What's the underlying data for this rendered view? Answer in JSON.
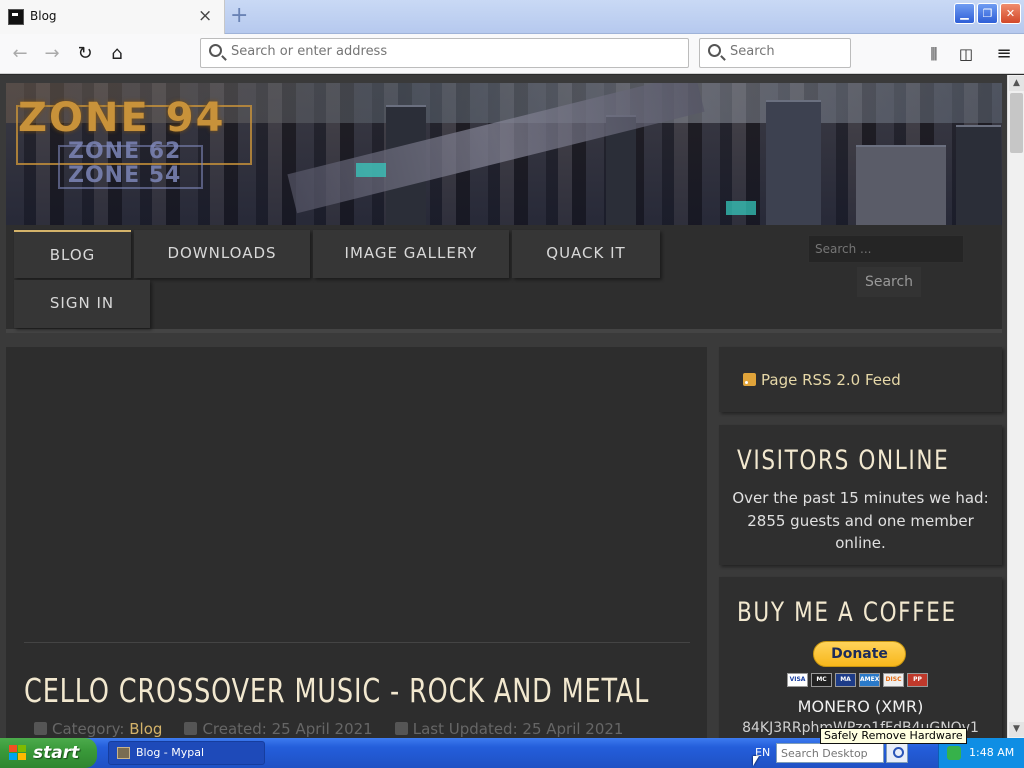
{
  "browser": {
    "tab_title": "Blog",
    "tab_close": "×",
    "new_tab": "+",
    "window_buttons": {
      "minimize": "▁",
      "restore": "❐",
      "close": "✕"
    },
    "address_placeholder": "Search or enter address",
    "search_placeholder": "Search",
    "nav_icons": [
      "back-icon",
      "forward-icon",
      "reload-icon",
      "home-icon",
      "library-icon",
      "sidebar-icon",
      "menu-icon"
    ]
  },
  "site": {
    "logo": {
      "main": "ZONE 94",
      "sub1": "ZONE 62",
      "sub2": "ZONE 54"
    },
    "menu": [
      {
        "label": "BLOG",
        "active": true
      },
      {
        "label": "DOWNLOADS"
      },
      {
        "label": "IMAGE GALLERY"
      },
      {
        "label": "QUACK IT"
      },
      {
        "label": "SIGN IN"
      }
    ],
    "search": {
      "placeholder": "Search ...",
      "button": "Search"
    },
    "article": {
      "title": "CELLO CROSSOVER MUSIC - ROCK AND METAL",
      "category_label": "Category:",
      "category_value": "Blog",
      "created": "Created: 25 April 2021",
      "updated": "Last Updated: 25 April 2021"
    },
    "sidebar": {
      "rss": "Page RSS 2.0 Feed",
      "visitors": {
        "title": "VISITORS ONLINE",
        "text": "Over the past 15 minutes we had: 2855 guests and one member online."
      },
      "coffee": {
        "title": "BUY ME A COFFEE",
        "donate": "Donate",
        "cards": [
          "VISA",
          "MC",
          "MA",
          "AMEX",
          "DISC",
          "PP"
        ],
        "currency": "MONERO (XMR)",
        "wallet": "84KJ3RRphmWPzo1fFdB4uGNQv1"
      }
    },
    "colors": {
      "accent": "#d4b36a",
      "title": "#f2e8cf",
      "background": "#2d2d2d"
    }
  },
  "taskbar": {
    "start": "start",
    "task": "Blog - Mypal",
    "lang": "EN",
    "desktop_search_placeholder": "Search Desktop",
    "tooltip": "Safely Remove Hardware",
    "clock": "1:48 AM"
  }
}
